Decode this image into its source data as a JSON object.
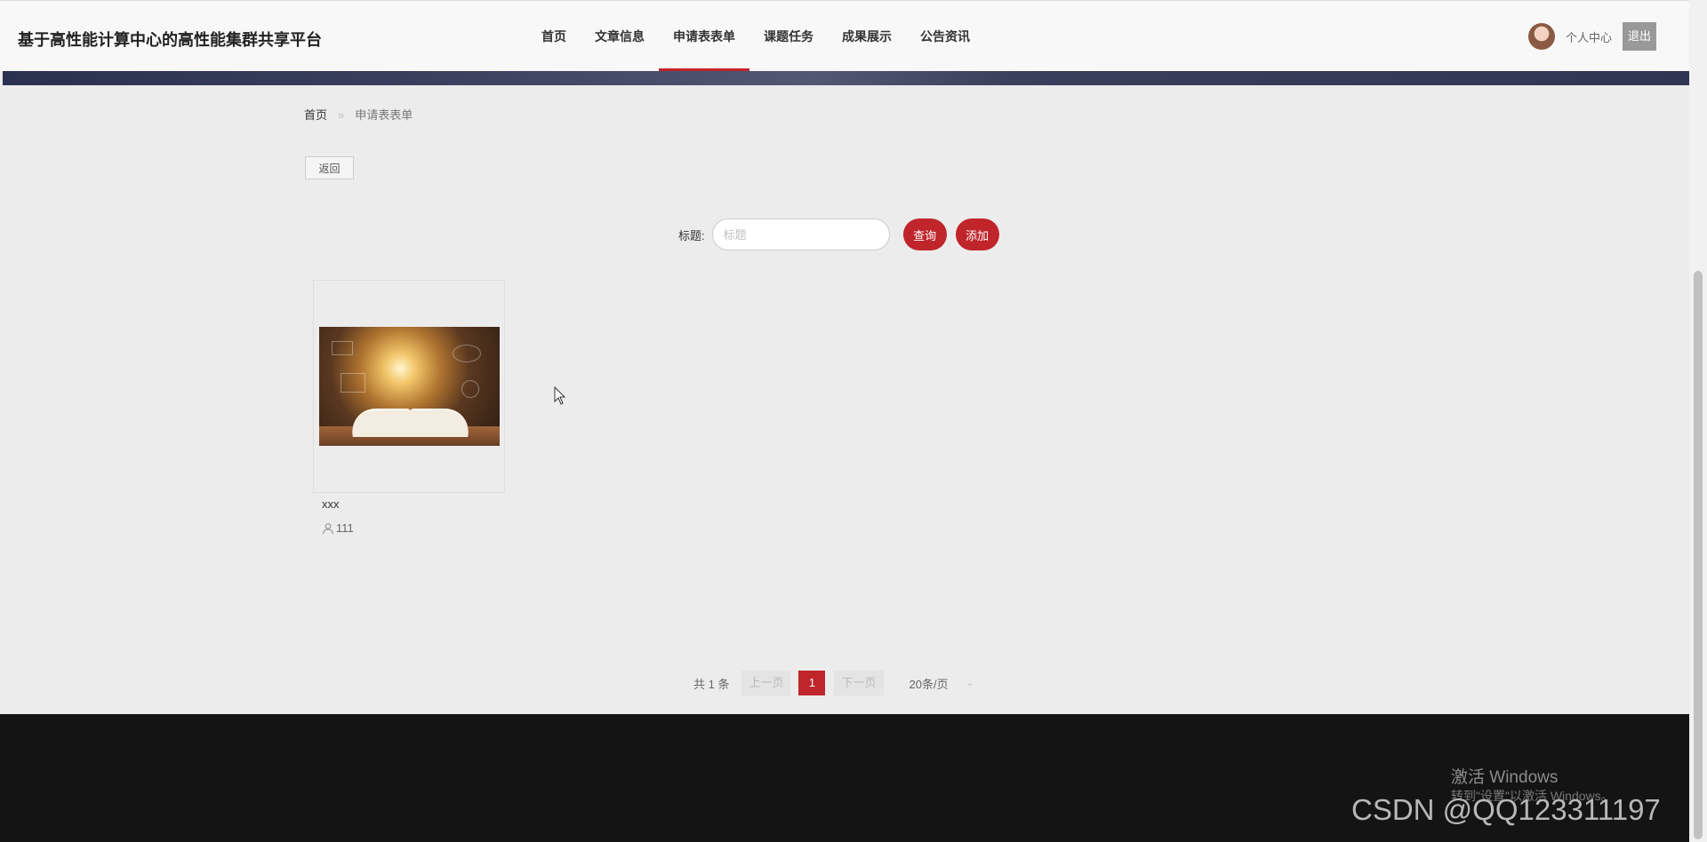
{
  "header": {
    "site_title": "基于高性能计算中心的高性能集群共享平台",
    "nav": [
      {
        "label": "首页",
        "active": false
      },
      {
        "label": "文章信息",
        "active": false
      },
      {
        "label": "申请表表单",
        "active": true
      },
      {
        "label": "课题任务",
        "active": false
      },
      {
        "label": "成果展示",
        "active": false
      },
      {
        "label": "公告资讯",
        "active": false
      }
    ],
    "personal_center": "个人中心",
    "logout": "退出"
  },
  "breadcrumb": {
    "home": "首页",
    "separator": "»",
    "current": "申请表表单"
  },
  "back_button": "返回",
  "search": {
    "label": "标题:",
    "placeholder": "标题",
    "query_button": "查询",
    "add_button": "添加"
  },
  "cards": [
    {
      "title": "xxx",
      "meta": "111",
      "icons": {
        "meta": "user-icon"
      }
    }
  ],
  "pagination": {
    "total": "共 1 条",
    "prev": "上一页",
    "current_page": "1",
    "next": "下一页",
    "page_size": "20条/页"
  },
  "watermarks": {
    "windows_title": "激活 Windows",
    "windows_sub": "转到\"设置\"以激活 Windows。",
    "csdn": "CSDN @QQ123311197"
  },
  "colors": {
    "accent": "#c0252b",
    "footer": "#141414",
    "background": "#ececec"
  }
}
